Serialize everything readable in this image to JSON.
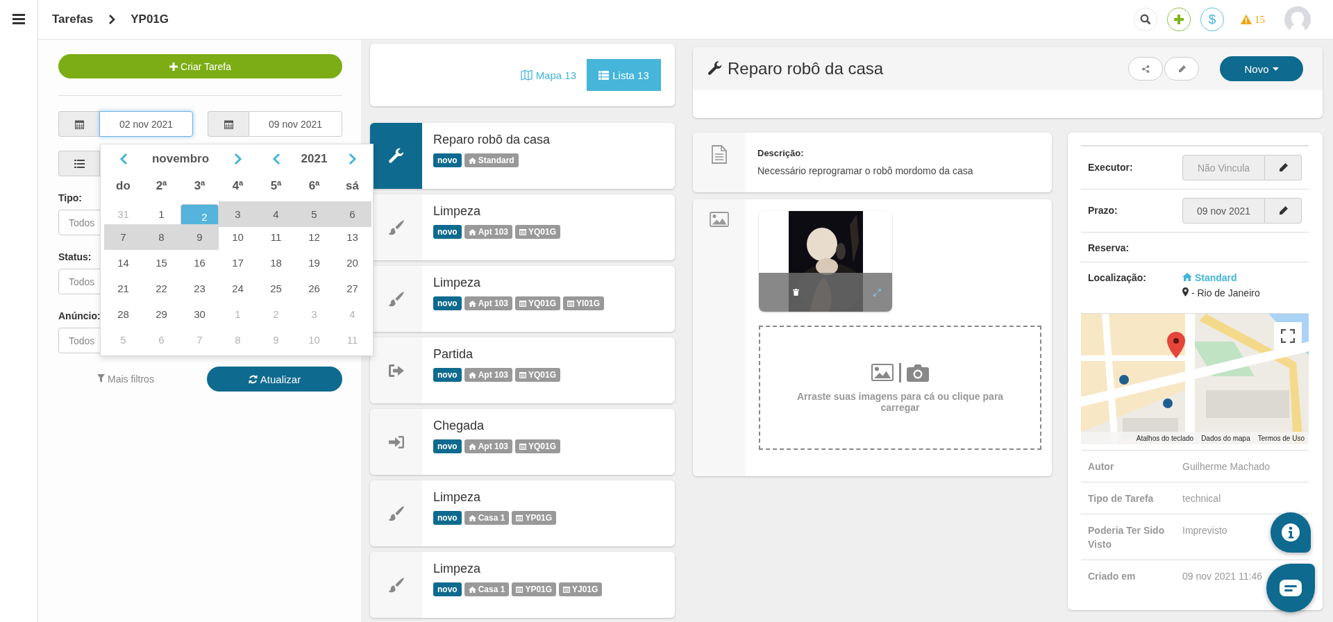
{
  "topbar": {
    "breadcrumb": [
      "Tarefas",
      "YP01G"
    ],
    "billing_symbol": "$",
    "alert_count": "15"
  },
  "filters": {
    "create_label": "Criar Tarefa",
    "date_from": {
      "value": "02 nov 2021",
      "focused": true
    },
    "date_to": {
      "value": "09 nov 2021",
      "focused": false
    },
    "selects": [
      {
        "label": "Tipo:",
        "value": "Todos"
      },
      {
        "label": "Status:",
        "value": "Todos"
      },
      {
        "label": "Anúncio:",
        "value": "Todos"
      }
    ],
    "more_filters": "Mais filtros",
    "refresh": "Atualizar"
  },
  "datepicker": {
    "month": "novembro",
    "year": "2021",
    "weekdays": [
      "do",
      "2ª",
      "3ª",
      "4ª",
      "5ª",
      "6ª",
      "sá"
    ],
    "weeks": [
      [
        {
          "day": "31",
          "muted": true,
          "selected": false,
          "in_range": false
        },
        {
          "day": "1",
          "muted": false,
          "selected": false,
          "in_range": false
        },
        {
          "day": "2",
          "muted": false,
          "selected": true,
          "in_range": false
        },
        {
          "day": "3",
          "muted": false,
          "selected": false,
          "in_range": true
        },
        {
          "day": "4",
          "muted": false,
          "selected": false,
          "in_range": true
        },
        {
          "day": "5",
          "muted": false,
          "selected": false,
          "in_range": true
        },
        {
          "day": "6",
          "muted": false,
          "selected": false,
          "in_range": true
        }
      ],
      [
        {
          "day": "7",
          "muted": false,
          "selected": false,
          "in_range": true
        },
        {
          "day": "8",
          "muted": false,
          "selected": false,
          "in_range": true
        },
        {
          "day": "9",
          "muted": false,
          "selected": false,
          "in_range": true
        },
        {
          "day": "10",
          "muted": false,
          "selected": false,
          "in_range": false
        },
        {
          "day": "11",
          "muted": false,
          "selected": false,
          "in_range": false
        },
        {
          "day": "12",
          "muted": false,
          "selected": false,
          "in_range": false
        },
        {
          "day": "13",
          "muted": false,
          "selected": false,
          "in_range": false
        }
      ],
      [
        {
          "day": "14",
          "muted": false,
          "selected": false,
          "in_range": false
        },
        {
          "day": "15",
          "muted": false,
          "selected": false,
          "in_range": false
        },
        {
          "day": "16",
          "muted": false,
          "selected": false,
          "in_range": false
        },
        {
          "day": "17",
          "muted": false,
          "selected": false,
          "in_range": false
        },
        {
          "day": "18",
          "muted": false,
          "selected": false,
          "in_range": false
        },
        {
          "day": "19",
          "muted": false,
          "selected": false,
          "in_range": false
        },
        {
          "day": "20",
          "muted": false,
          "selected": false,
          "in_range": false
        }
      ],
      [
        {
          "day": "21",
          "muted": false,
          "selected": false,
          "in_range": false
        },
        {
          "day": "22",
          "muted": false,
          "selected": false,
          "in_range": false
        },
        {
          "day": "23",
          "muted": false,
          "selected": false,
          "in_range": false
        },
        {
          "day": "24",
          "muted": false,
          "selected": false,
          "in_range": false
        },
        {
          "day": "25",
          "muted": false,
          "selected": false,
          "in_range": false
        },
        {
          "day": "26",
          "muted": false,
          "selected": false,
          "in_range": false
        },
        {
          "day": "27",
          "muted": false,
          "selected": false,
          "in_range": false
        }
      ],
      [
        {
          "day": "28",
          "muted": false,
          "selected": false,
          "in_range": false
        },
        {
          "day": "29",
          "muted": false,
          "selected": false,
          "in_range": false
        },
        {
          "day": "30",
          "muted": false,
          "selected": false,
          "in_range": false
        },
        {
          "day": "1",
          "muted": true,
          "selected": false,
          "in_range": false
        },
        {
          "day": "2",
          "muted": true,
          "selected": false,
          "in_range": false
        },
        {
          "day": "3",
          "muted": true,
          "selected": false,
          "in_range": false
        },
        {
          "day": "4",
          "muted": true,
          "selected": false,
          "in_range": false
        }
      ],
      [
        {
          "day": "5",
          "muted": true,
          "selected": false,
          "in_range": false
        },
        {
          "day": "6",
          "muted": true,
          "selected": false,
          "in_range": false
        },
        {
          "day": "7",
          "muted": true,
          "selected": false,
          "in_range": false
        },
        {
          "day": "8",
          "muted": true,
          "selected": false,
          "in_range": false
        },
        {
          "day": "9",
          "muted": true,
          "selected": false,
          "in_range": false
        },
        {
          "day": "10",
          "muted": true,
          "selected": false,
          "in_range": false
        },
        {
          "day": "11",
          "muted": true,
          "selected": false,
          "in_range": false
        }
      ]
    ]
  },
  "view_toggle": [
    {
      "label": "Mapa 13",
      "kind": "map",
      "selected": false
    },
    {
      "label": "Lista 13",
      "kind": "list",
      "selected": true
    }
  ],
  "tasks": [
    {
      "title": "Reparo robô da casa",
      "kind": "repair",
      "selected": true,
      "tags": [
        {
          "kind": "status",
          "text": "novo"
        },
        {
          "kind": "place",
          "text": "Standard"
        }
      ]
    },
    {
      "title": "Limpeza",
      "kind": "cleaning",
      "selected": false,
      "tags": [
        {
          "kind": "status",
          "text": "novo"
        },
        {
          "kind": "place",
          "text": "Apt 103"
        },
        {
          "kind": "booking",
          "text": "YQ01G"
        }
      ]
    },
    {
      "title": "Limpeza",
      "kind": "cleaning",
      "selected": false,
      "tags": [
        {
          "kind": "status",
          "text": "novo"
        },
        {
          "kind": "place",
          "text": "Apt 103"
        },
        {
          "kind": "booking",
          "text": "YQ01G"
        },
        {
          "kind": "booking",
          "text": "YI01G"
        }
      ]
    },
    {
      "title": "Partida",
      "kind": "checkout",
      "selected": false,
      "tags": [
        {
          "kind": "status",
          "text": "novo"
        },
        {
          "kind": "place",
          "text": "Apt 103"
        },
        {
          "kind": "booking",
          "text": "YQ01G"
        }
      ]
    },
    {
      "title": "Chegada",
      "kind": "checkin",
      "selected": false,
      "tags": [
        {
          "kind": "status",
          "text": "novo"
        },
        {
          "kind": "place",
          "text": "Apt 103"
        },
        {
          "kind": "booking",
          "text": "YQ01G"
        }
      ]
    },
    {
      "title": "Limpeza",
      "kind": "cleaning",
      "selected": false,
      "tags": [
        {
          "kind": "status",
          "text": "novo"
        },
        {
          "kind": "place",
          "text": "Casa 1"
        },
        {
          "kind": "booking",
          "text": "YP01G"
        }
      ]
    },
    {
      "title": "Limpeza",
      "kind": "cleaning",
      "selected": false,
      "tags": [
        {
          "kind": "status",
          "text": "novo"
        },
        {
          "kind": "place",
          "text": "Casa 1"
        },
        {
          "kind": "booking",
          "text": "YP01G"
        },
        {
          "kind": "booking",
          "text": "YJ01G"
        }
      ]
    }
  ],
  "detail": {
    "title": "Reparo robô da casa",
    "action": "Novo",
    "description": {
      "label": "Descrição:",
      "text": "Necessário reprogramar o robô mordomo da casa"
    },
    "upload_hint": "Arraste suas imagens para cá ou clique para carregar"
  },
  "info": {
    "rows": [
      {
        "kind": "field",
        "label": "Executor:",
        "value": "Não Vincula",
        "empty": true
      },
      {
        "kind": "field",
        "label": "Prazo:",
        "value": "09 nov 2021",
        "empty": false
      },
      {
        "kind": "plain",
        "label": "Reserva:"
      },
      {
        "kind": "location",
        "label": "Localização:",
        "place": "Standard",
        "city": "- Rio de Janeiro"
      }
    ],
    "map": {
      "attribution": [
        "Atalhos do teclado",
        "Dados do mapa",
        "Termos de Uso"
      ]
    },
    "meta": [
      {
        "label": "Autor",
        "value": "Guilherme Machado"
      },
      {
        "label": "Tipo de Tarefa",
        "value": "technical"
      },
      {
        "label": "Poderia Ter Sido Visto",
        "value": "Imprevisto"
      },
      {
        "label": "Criado em",
        "value": "09 nov 2021 11:46"
      }
    ]
  }
}
